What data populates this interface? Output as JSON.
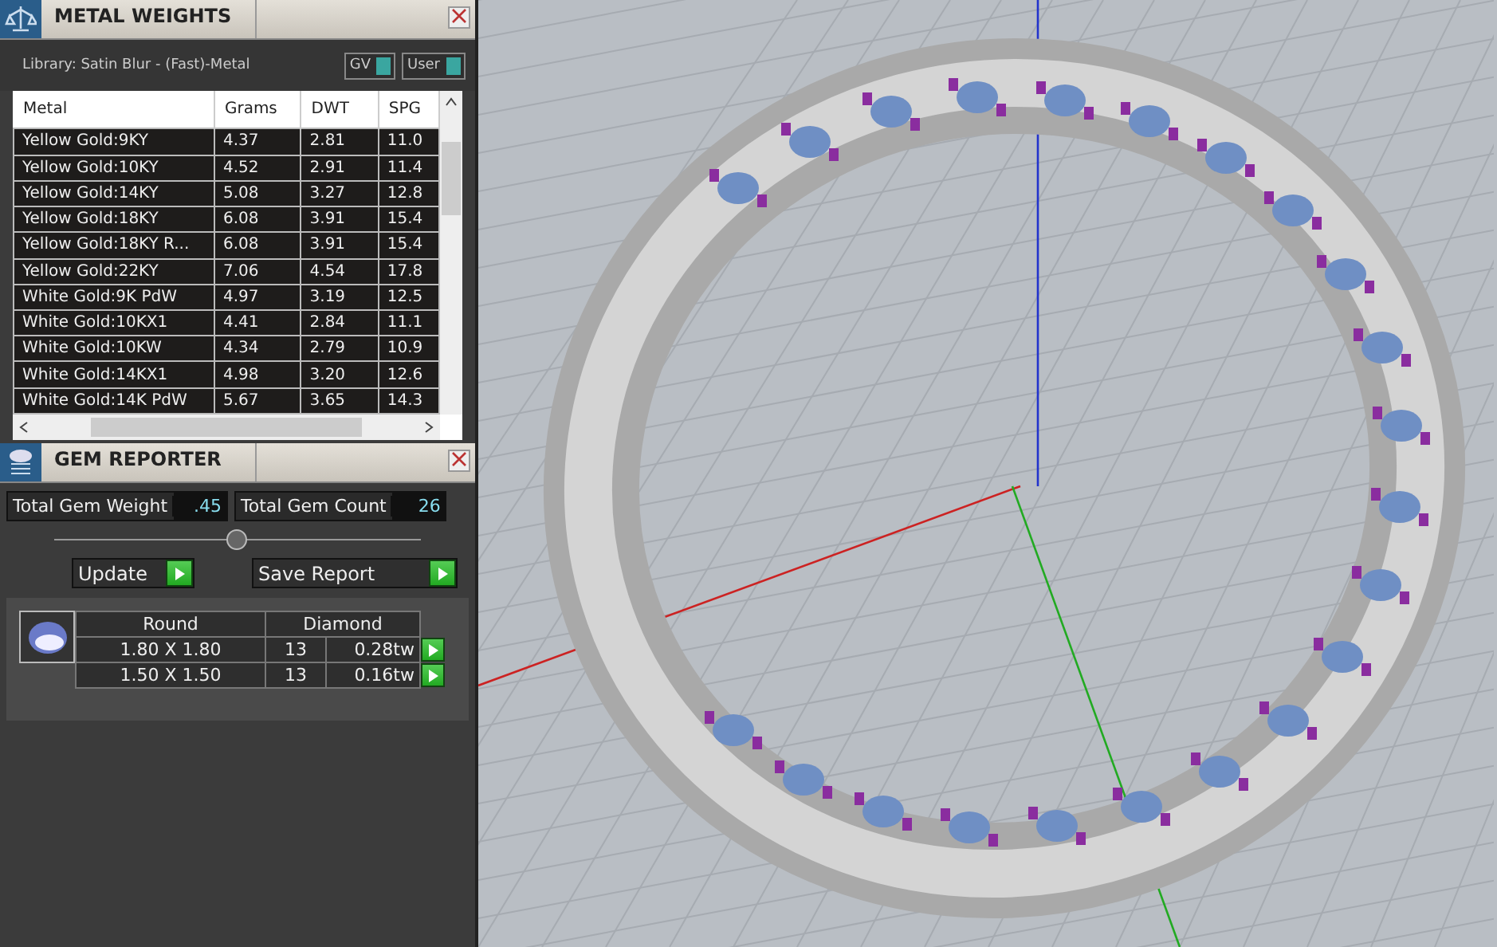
{
  "metal_weights": {
    "title": "METAL WEIGHTS",
    "library": "Library: Satin Blur - (Fast)-Metal",
    "toggles": [
      {
        "label": "GV",
        "on": true
      },
      {
        "label": "User",
        "on": true
      }
    ],
    "table": {
      "columns": [
        "Metal",
        "Grams",
        "DWT",
        "SPG"
      ],
      "rows": [
        [
          "Yellow Gold:9KY",
          "4.37",
          "2.81",
          "11.0"
        ],
        [
          "Yellow Gold:10KY",
          "4.52",
          "2.91",
          "11.4"
        ],
        [
          "Yellow Gold:14KY",
          "5.08",
          "3.27",
          "12.8"
        ],
        [
          "Yellow Gold:18KY",
          "6.08",
          "3.91",
          "15.4"
        ],
        [
          "Yellow Gold:18KY R...",
          "6.08",
          "3.91",
          "15.4"
        ],
        [
          "Yellow Gold:22KY",
          "7.06",
          "4.54",
          "17.8"
        ],
        [
          "White Gold:9K PdW",
          "4.97",
          "3.19",
          "12.5"
        ],
        [
          "White Gold:10KX1",
          "4.41",
          "2.84",
          "11.1"
        ],
        [
          "White Gold:10KW",
          "4.34",
          "2.79",
          "10.9"
        ],
        [
          "White Gold:14KX1",
          "4.98",
          "3.20",
          "12.6"
        ],
        [
          "White Gold:14K PdW",
          "5.67",
          "3.65",
          "14.3"
        ]
      ]
    }
  },
  "gem_reporter": {
    "title": "GEM REPORTER",
    "total_weight_label": "Total Gem Weight",
    "total_weight": ".45",
    "total_count_label": "Total Gem Count",
    "total_count": "26",
    "buttons": [
      "Update",
      "Save Report"
    ],
    "gems": {
      "shape": "Round",
      "material": "Diamond",
      "rows": [
        [
          "1.80 X 1.80",
          "13",
          "0.28tw"
        ],
        [
          "1.50 X 1.50",
          "13",
          "0.16tw"
        ]
      ]
    }
  }
}
